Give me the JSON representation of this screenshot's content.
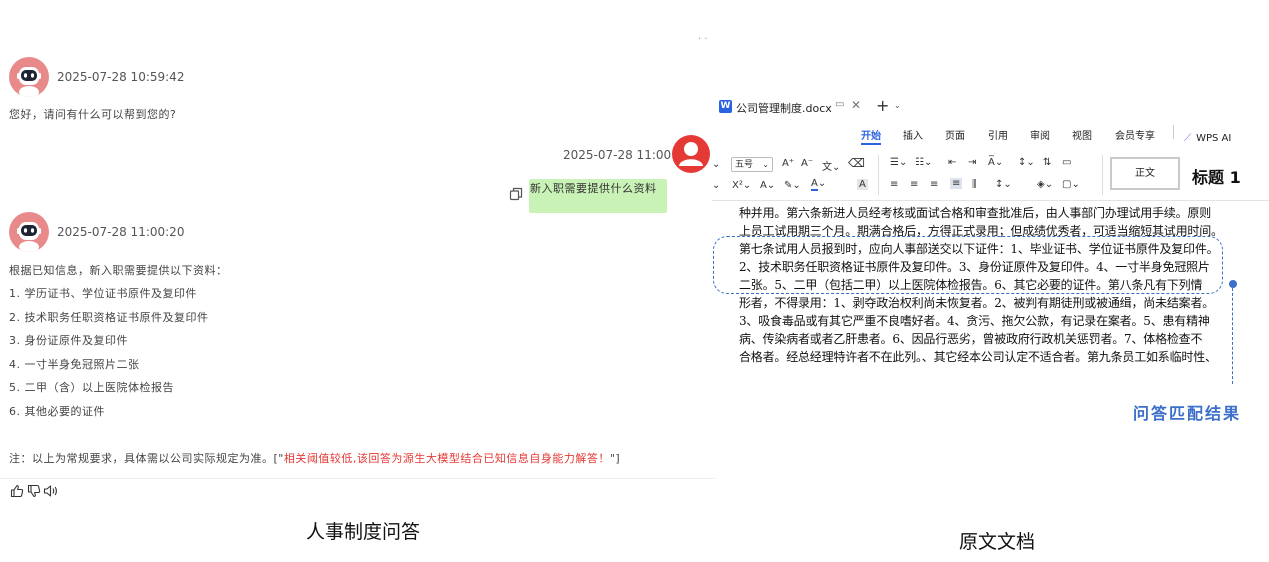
{
  "chat": {
    "top_dots": "· ·",
    "msg1": {
      "timestamp": "2025-07-28 10:59:42",
      "text": "您好，请问有什么可以帮到您的?"
    },
    "user_msg": {
      "timestamp": "2025-07-28 11:00:19",
      "text": "新入职需要提供什么资料"
    },
    "msg2": {
      "timestamp": "2025-07-28 11:00:20",
      "intro": "根据已知信息，新入职需要提供以下资料：",
      "items": [
        "1. 学历证书、学位证书原件及复印件",
        "2. 技术职务任职资格证书原件及复印件",
        "3. 身份证原件及复印件",
        "4. 一寸半身免冠照片二张",
        "5. 二甲（含）以上医院体检报告",
        "6. 其他必要的证件"
      ],
      "note_prefix": "注：以上为常规要求，具体需以公司实际规定为准。[\"",
      "note_red": "相关阈值较低,该回答为源生大模型结合已知信息自身能力解答！",
      "note_suffix": "\"]"
    },
    "caption": "人事制度问答",
    "colors": {
      "bubble": "#c9f2b6",
      "warning_red": "#e53935",
      "avatar_bot": "#e98a8a",
      "avatar_user": "#e53935"
    }
  },
  "wps": {
    "tab_title": "公司管理制度.docx",
    "ribbon_tabs": [
      "开始",
      "插入",
      "页面",
      "引用",
      "审阅",
      "视图",
      "会员专享"
    ],
    "active_tab": "开始",
    "wps_ai": "WPS AI",
    "font_size": "五号",
    "style_normal": "正文",
    "style_heading": "标题 1",
    "doc_lines": [
      "种并用。第六条新进人员经考核或面试合格和审查批准后，由人事部门办理试用手续。原则",
      "上员工试用期三个月。期满合格后，方得正式录用；但成绩优秀者，可适当缩短其试用时间。",
      "第七条试用人员报到时，应向人事部送交以下证件：1、毕业证书、学位证书原件及复印件。",
      "2、技术职务任职资格证书原件及复印件。3、身份证原件及复印件。4、一寸半身免冠照片",
      "二张。5、二甲（包括二甲）以上医院体检报告。6、其它必要的证件。第八条凡有下列情",
      "形者，不得录用：1、剥夺政治权利尚未恢复者。2、被判有期徒刑或被通缉，尚未结案者。",
      "3、吸食毒品或有其它严重不良嗜好者。4、贪污、拖欠公款，有记录在案者。5、患有精神",
      "病、传染病者或者乙肝患者。6、因品行恶劣，曾被政府行政机关惩罚者。7、体格检查不",
      "合格者。经总经理特许者不在此列。、其它经本公司认定不适合者。第九条员工如系临时性、"
    ],
    "match_label": "问答匹配结果",
    "caption": "原文文档",
    "colors": {
      "accent_blue": "#2b62e0",
      "match_blue": "#3b6fc9"
    }
  }
}
